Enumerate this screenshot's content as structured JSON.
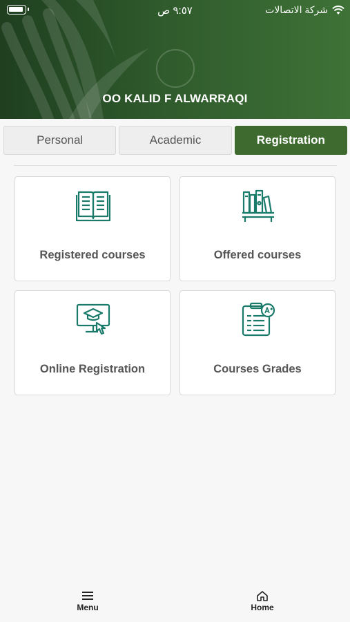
{
  "status_bar": {
    "time": "٩:٥٧ ص",
    "carrier": "شركة الاتصالات"
  },
  "header": {
    "user_name": "OO KALID F ALWARRAQI"
  },
  "tabs": [
    {
      "label": "Personal",
      "active": false
    },
    {
      "label": "Academic",
      "active": false
    },
    {
      "label": "Registration",
      "active": true
    }
  ],
  "cards": [
    {
      "label": "Registered courses",
      "icon": "open-book-icon"
    },
    {
      "label": "Offered courses",
      "icon": "bookshelf-icon"
    },
    {
      "label": "Online Registration",
      "icon": "computer-graduation-icon"
    },
    {
      "label": "Courses Grades",
      "icon": "grade-report-icon"
    }
  ],
  "bottom_nav": {
    "menu_label": "Menu",
    "home_label": "Home"
  },
  "colors": {
    "accent": "#3e6a30",
    "icon": "#1a7a6a"
  }
}
